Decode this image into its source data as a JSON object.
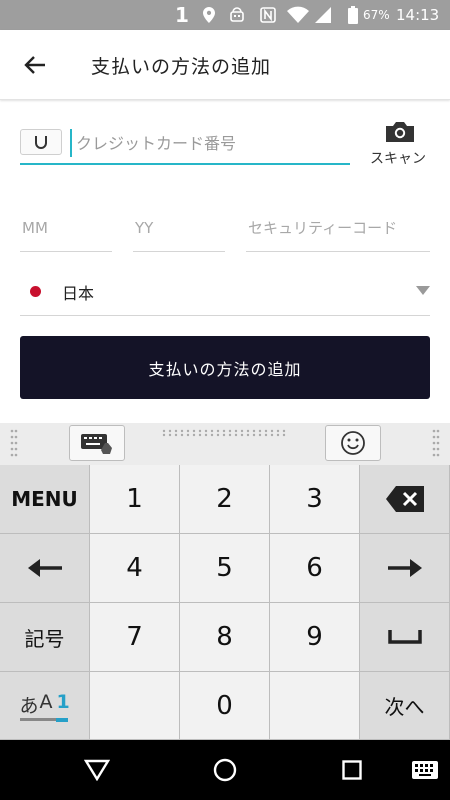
{
  "status_bar": {
    "notification_count": "1",
    "battery_percent": "67%",
    "time": "14:13",
    "icons": [
      "location-icon",
      "android-icon",
      "nfc-icon",
      "wifi-icon",
      "signal-icon",
      "battery-icon"
    ]
  },
  "app_bar": {
    "title": "支払いの方法の追加",
    "back_icon": "arrow-back-icon"
  },
  "form": {
    "card_number_placeholder": "クレジットカード番号",
    "card_number_value": "",
    "scan_label": "スキャン",
    "mm_placeholder": "MM",
    "yy_placeholder": "YY",
    "security_placeholder": "セキュリティーコード",
    "country": "日本",
    "submit_label": "支払いの方法の追加"
  },
  "keyboard": {
    "toolbar_icons": [
      "keyboard-switch-icon",
      "emoji-icon"
    ],
    "keys": {
      "menu": "MENU",
      "k1": "1",
      "k2": "2",
      "k3": "3",
      "k4": "4",
      "k5": "5",
      "k6": "6",
      "k7": "7",
      "k8": "8",
      "k9": "9",
      "k0": "0",
      "symbols": "記号",
      "mode_a": "あ",
      "mode_b": "A",
      "mode_c": "1",
      "next": "次へ"
    }
  },
  "colors": {
    "accent": "#26b6c8",
    "button": "#141327",
    "flag": "#c8102e"
  }
}
